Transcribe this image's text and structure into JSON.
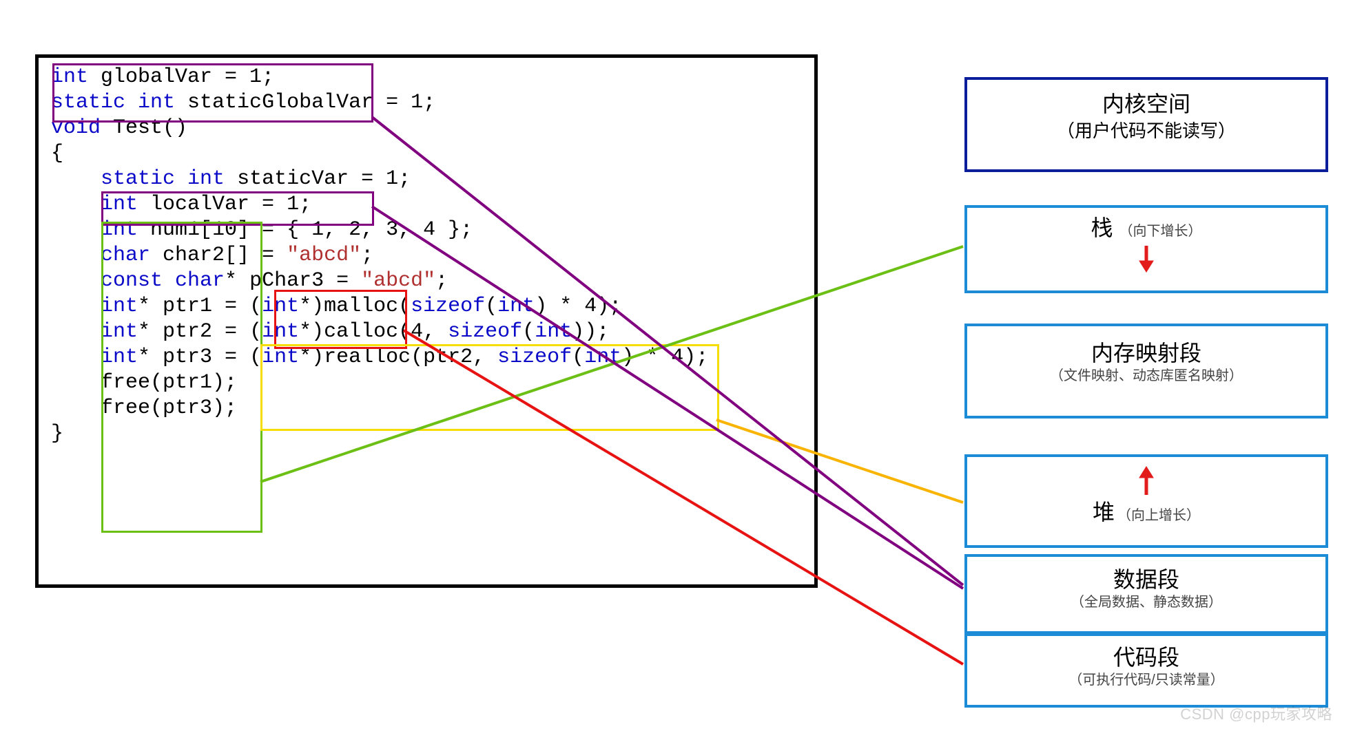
{
  "code": {
    "l1": {
      "pre": "",
      "kw": "int ",
      "rest": "globalVar = 1;"
    },
    "l2a": {
      "kw": "static int "
    },
    "l2b": "staticGlobalVar = 1;",
    "l3": {
      "kw": "void ",
      "rest": "Test()"
    },
    "l4": "{",
    "l5a": {
      "kw": "static int "
    },
    "l5b": "staticVar = 1;",
    "l6": {
      "kw": "int ",
      "rest": "localVar = 1;"
    },
    "l7": {
      "kw": "int ",
      "rest": "num1[10] = { 1, 2, 3, 4 };"
    },
    "l8": {
      "kw": "char ",
      "mid": "char2[] = ",
      "str": "\"abcd\"",
      "end": ";"
    },
    "l9": {
      "kw": "const char",
      "star": "* ",
      "mid": "pChar3 = ",
      "str": "\"abcd\"",
      "end": ";"
    },
    "l10": {
      "kw1": "int",
      "star": "* ",
      "a": "ptr1 = (",
      "kw2": "int",
      "b": "*)malloc(",
      "kw3": "sizeof",
      "c": "(",
      "kw4": "int",
      "d": ") * 4);"
    },
    "l11": {
      "kw1": "int",
      "star": "* ",
      "a": "ptr2 = (",
      "kw2": "int",
      "b": "*)calloc(4, ",
      "kw3": "sizeof",
      "c": "(",
      "kw4": "int",
      "d": "));"
    },
    "l12": {
      "kw1": "int",
      "star": "* ",
      "a": "ptr3 = (",
      "kw2": "int",
      "b": "*)realloc(ptr2, ",
      "kw3": "sizeof",
      "c": "(",
      "kw4": "int",
      "d": ") * 4);"
    },
    "l13": "free(ptr1);",
    "l14": "free(ptr3);",
    "l15": "}"
  },
  "memory": {
    "kernel_t": "内核空间",
    "kernel_s": "（用户代码不能读写）",
    "stack_t1": "栈 ",
    "stack_t2": "（向下增长）",
    "mmap_t": "内存映射段",
    "mmap_s": "（文件映射、动态库匿名映射）",
    "heap_t1": "堆",
    "heap_t2": "（向上增长）",
    "data_t": "数据段",
    "data_s": "（全局数据、静态数据）",
    "code_t": "代码段",
    "code_s": "（可执行代码/只读常量）"
  },
  "highlights": {
    "purple1": "purple",
    "purple2": "purple",
    "green": "#6cc015",
    "red": "#e71313",
    "yellow": "#f5dd00"
  },
  "lines": {
    "stack": {
      "color": "#6cc015"
    },
    "heap": {
      "color": "#f8b400"
    },
    "data1": {
      "color": "purple"
    },
    "data2": {
      "color": "purple"
    },
    "code": {
      "color": "#e71313"
    }
  },
  "watermark": "CSDN @cpp玩家攻略"
}
